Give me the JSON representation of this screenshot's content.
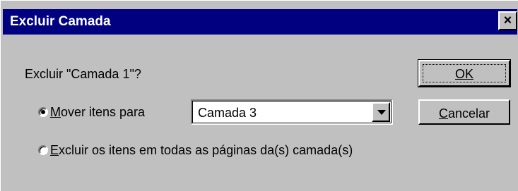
{
  "dialog": {
    "title": "Excluir Camada",
    "close_glyph": "×",
    "prompt": "Excluir \"Camada 1\"?"
  },
  "options": {
    "move": {
      "label": "Mover itens para",
      "accesskey": "M",
      "checked": true
    },
    "delete": {
      "label": "Excluir os itens em todas as páginas da(s) camada(s)",
      "accesskey": "E",
      "checked": false
    }
  },
  "layer_select": {
    "value": "Camada 3"
  },
  "buttons": {
    "ok": "OK",
    "cancel": "Cancelar"
  },
  "icons": {
    "close": "close-icon",
    "dropdown": "chevron-down-icon",
    "radio_selected": "radio-selected-icon",
    "radio_unselected": "radio-unselected-icon"
  },
  "colors": {
    "titlebar": "#000080",
    "face": "#c0c0c0"
  }
}
